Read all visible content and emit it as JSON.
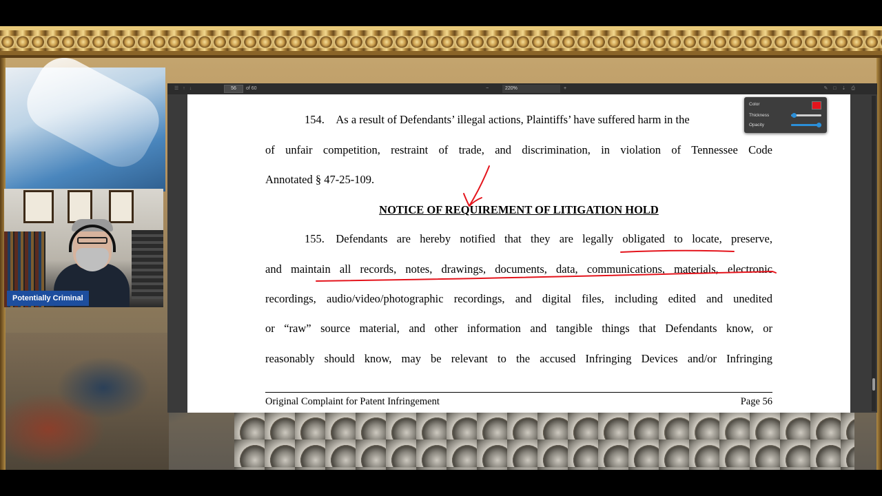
{
  "overlay": {
    "webcam_name": "Potentially Criminal"
  },
  "viewer": {
    "page_number": "56",
    "page_total": "of 60",
    "zoom": "220%",
    "ink_panel": {
      "color_label": "Color",
      "thickness_label": "Thickness",
      "opacity_label": "Opacity",
      "color_value": "#e4141c",
      "thickness_level": 0.1,
      "opacity_level": 1.0
    }
  },
  "document": {
    "para154_line1": "154. As a result of Defendants’ illegal actions, Plaintiffs’ have suffered harm in the",
    "para154_line2": "of unfair competition, restraint of trade, and discrimination, in violation of Tennessee Code",
    "para154_line3": "Annotated § 47-25-109.",
    "heading": "NOTICE OF REQUIREMENT OF LITIGATION HOLD",
    "para155_line1": "155. Defendants are hereby notified that they are legally obligated to locate, preserve,",
    "para155_line2": "and maintain all records, notes, drawings, documents, data, communications, materials, electronic",
    "para155_line3": "recordings, audio/video/photographic recordings, and digital files, including edited and unedited",
    "para155_line4": "or “raw” source material, and other information and tangible things that Defendants know, or",
    "para155_line5": "reasonably should know, may be relevant to the accused Infringing Devices and/or Infringing",
    "footer_left": "Original Complaint for Patent Infringement",
    "footer_right": "Page 56"
  },
  "annotations": {
    "ink_color": "#e4141c",
    "items": [
      "arrow",
      "underline-obligated-preserve",
      "underline-maintain-electronic"
    ]
  }
}
